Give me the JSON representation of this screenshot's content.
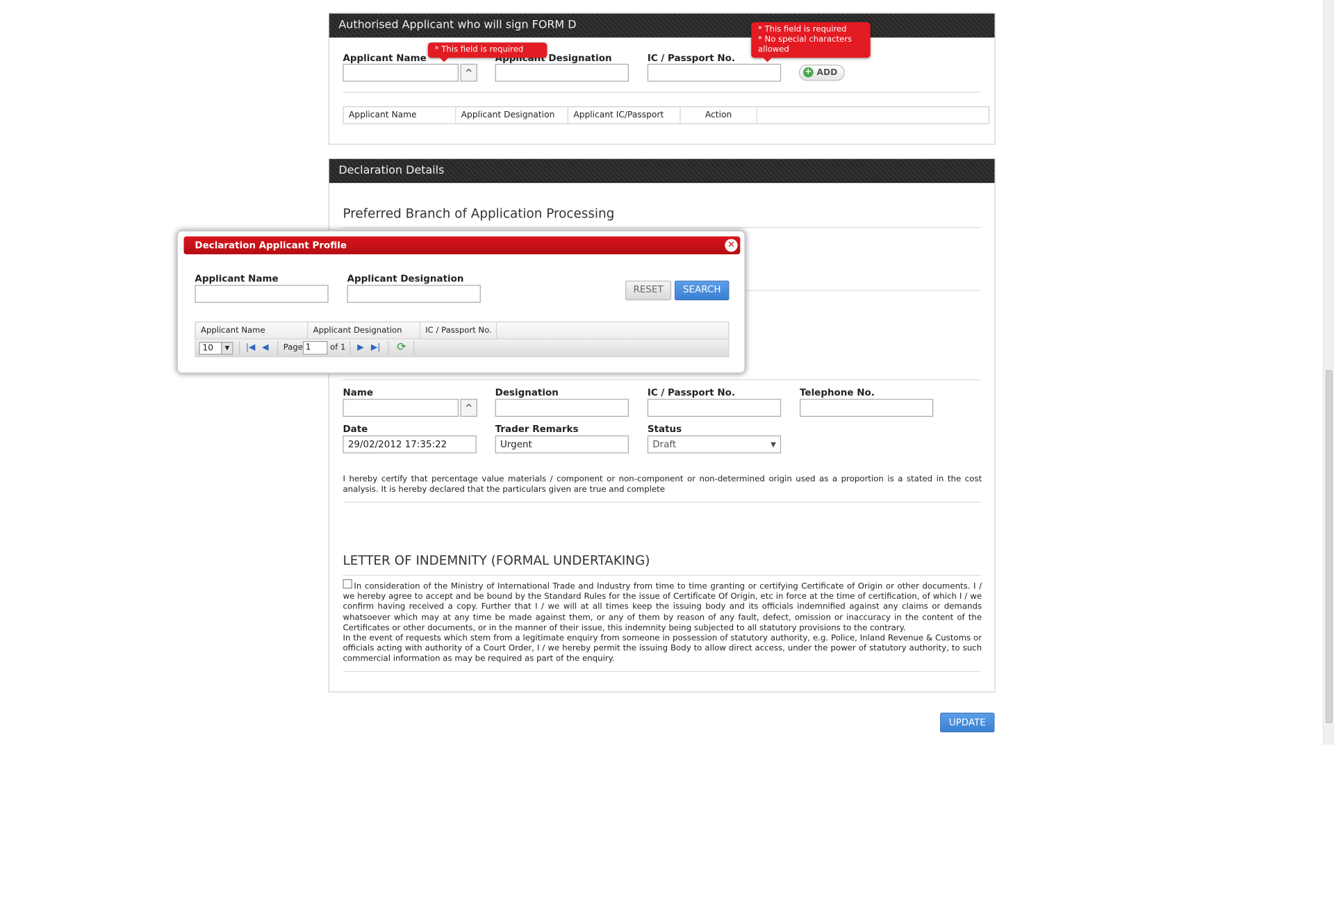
{
  "panel_authorised": {
    "title": "Authorised Applicant who will sign FORM D",
    "applicant_name_label": "Applicant Name",
    "applicant_designation_label": "Applicant Designation",
    "ic_passport_label": "IC / Passport No.",
    "pick_button": "^",
    "add_button": "ADD",
    "error_required": "* This field is required",
    "error_ic_line1": "* This field is required",
    "error_ic_line2": "* No special characters",
    "error_ic_line3": "allowed",
    "table_headers": [
      "Applicant Name",
      "Applicant Designation",
      "Applicant IC/Passport",
      "Action"
    ]
  },
  "panel_declaration": {
    "title": "Declaration Details",
    "preferred_branch_title": "Preferred Branch of Application Processing",
    "name_label": "Name",
    "pick_button": "^",
    "designation_label": "Designation",
    "ic_passport_label": "IC / Passport No.",
    "telephone_label": "Telephone No.",
    "date_label": "Date",
    "date_value": "29/02/2012 17:35:22",
    "trader_remarks_label": "Trader Remarks",
    "trader_remarks_value": "Urgent",
    "status_label": "Status",
    "status_value": "Draft",
    "certify_text": "I hereby certify that percentage value materials / component or non-component or non-determined origin used as a proportion is a stated in the cost analysis. It is hereby declared that the particulars given are true and complete",
    "indemnity_title": "LETTER OF INDEMNITY (FORMAL UNDERTAKING)",
    "indemnity_p1": "In consideration of the Ministry of International Trade and Industry from time to time granting or certifying Certificate of Origin or other documents. I / we hereby agree to accept and be bound by the Standard Rules for the issue of Certificate Of Origin, etc in force at the time of certification, of which I / we confirm having received a copy. Further that I / we will at all times keep the issuing body and its officials indemnified against any claims or demands whatsoever which may at any time be made against them, or any of them by reason of any fault, defect, omission or inaccuracy in the content of the Certificates or other documents, or in the manner of their issue, this indemnity being subjected to all statutory provisions to the contrary.",
    "indemnity_p2": "In the event of requests which stem from a legitimate enquiry from someone in possession of statutory authority, e.g. Police, Inland Revenue & Customs or officials acting with authority of a Court Order, I / we hereby permit the issuing Body to allow direct access, under the power of statutory authority, to such commercial information as may be required as part of the enquiry."
  },
  "update_button": "UPDATE",
  "modal": {
    "title": "Declaration Applicant Profile",
    "applicant_name_label": "Applicant Name",
    "applicant_designation_label": "Applicant Designation",
    "reset_button": "RESET",
    "search_button": "SEARCH",
    "grid_headers": [
      "Applicant Name",
      "Applicant Designation",
      "IC / Passport No."
    ],
    "pager": {
      "page_size": "10",
      "page_label": "Page",
      "page_value": "1",
      "of_label": "of 1"
    }
  },
  "colors": {
    "header_dark": "#2e2e2e",
    "modal_red": "#c8111a",
    "error_red": "#e31b23",
    "button_blue": "#3a7fd2"
  },
  "icons": [
    "close-icon",
    "add-icon",
    "first-page-icon",
    "prev-page-icon",
    "next-page-icon",
    "last-page-icon",
    "refresh-icon",
    "dropdown-arrow-icon"
  ]
}
